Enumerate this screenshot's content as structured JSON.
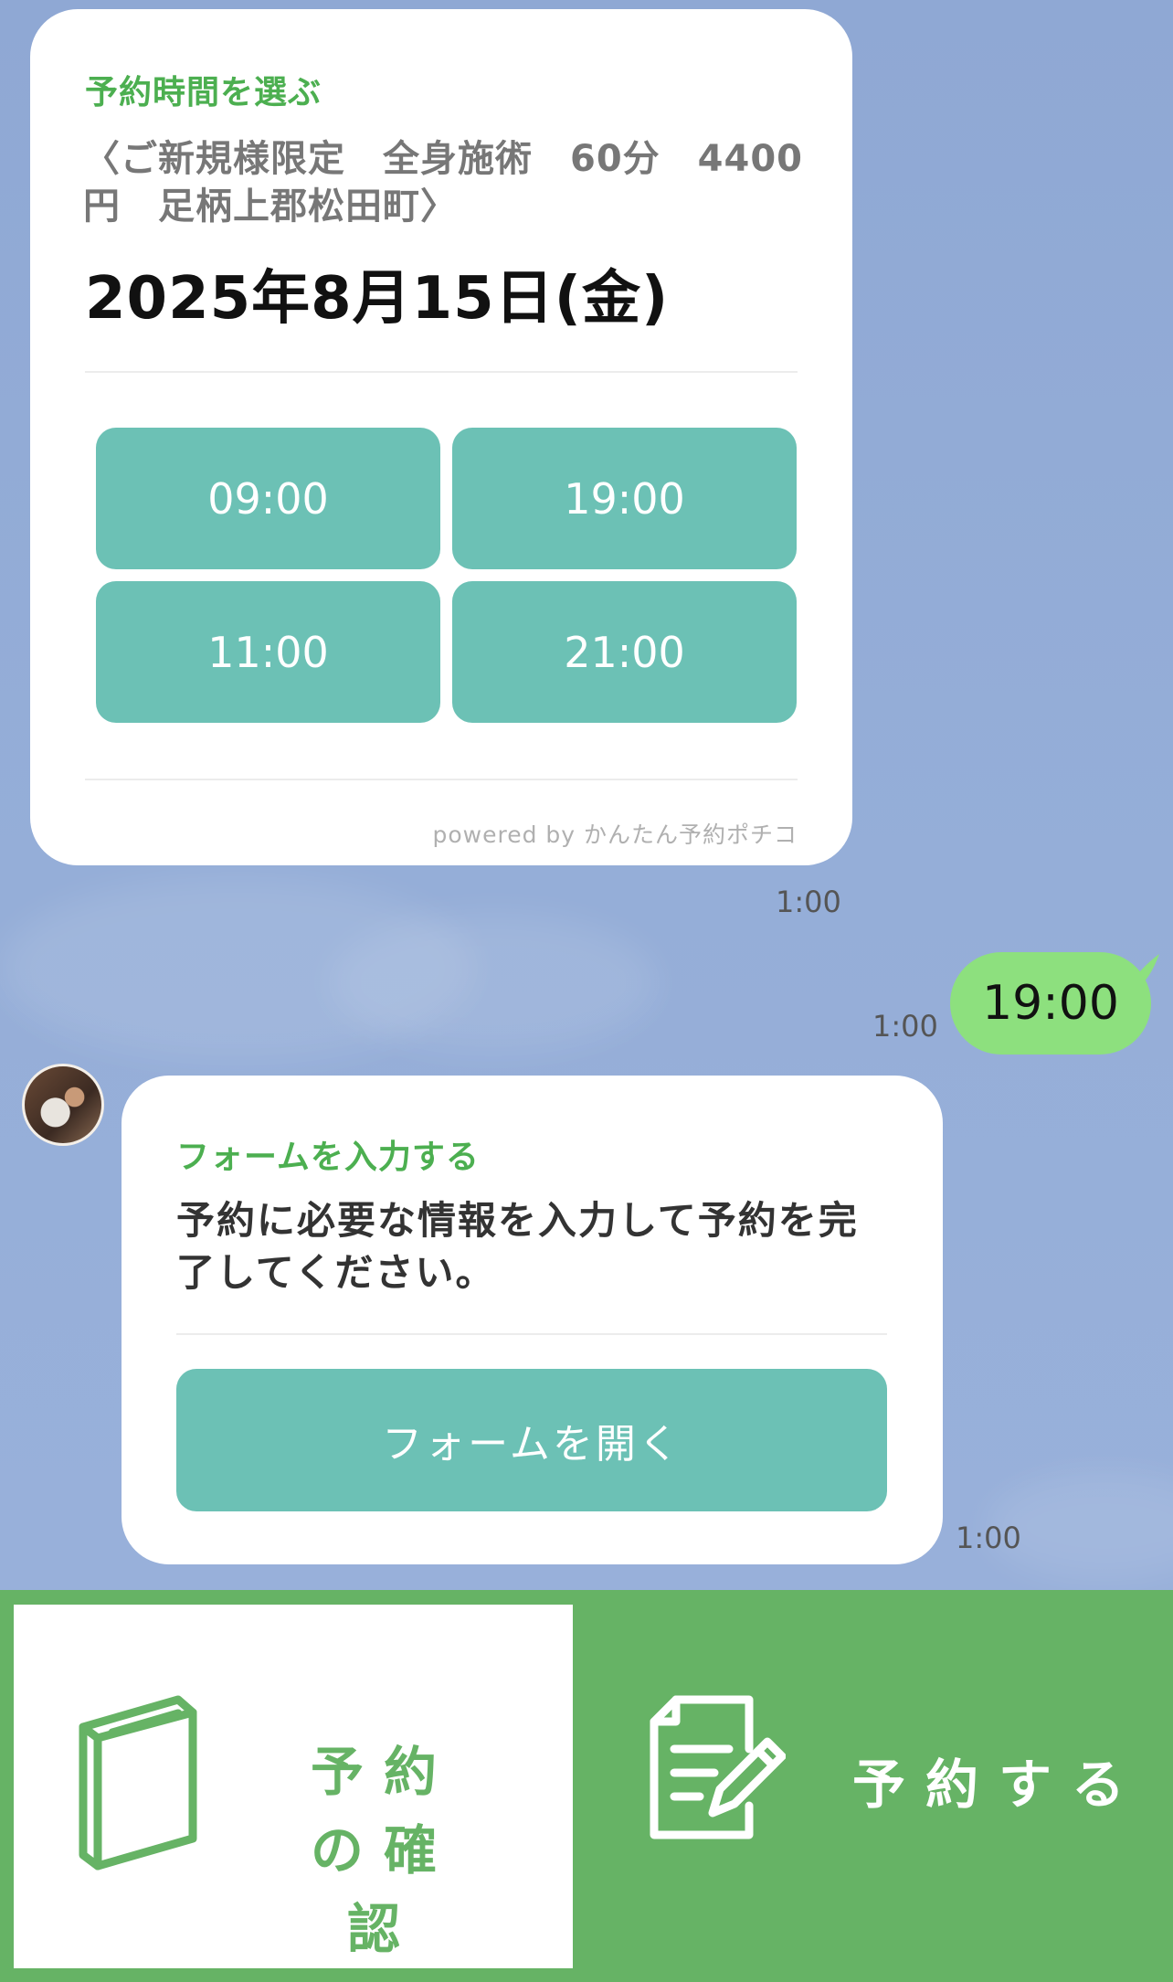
{
  "timeslot_card": {
    "label": "予約時間を選ぶ",
    "subtitle": "〈ご新規様限定　全身施術　60分　4400円　足柄上郡松田町〉",
    "date": "2025年8月15日(金)",
    "slots": [
      "09:00",
      "19:00",
      "11:00",
      "21:00"
    ],
    "powered_by": "powered by かんたん予約ポチコ",
    "time": "1:00"
  },
  "sent_message": {
    "text": "19:00",
    "time": "1:00"
  },
  "form_card": {
    "label": "フォームを入力する",
    "message": "予約に必要な情報を入力して予約を完了してください。",
    "button": "フォームを開く",
    "time": "1:00"
  },
  "rich_menu": {
    "left_label": "予約の確認",
    "left_icon": "book-icon",
    "right_label": "予約する",
    "right_icon": "document-pen-icon",
    "accent": "#66b365"
  },
  "colors": {
    "chat_background": "#92abd4",
    "teal_button": "#6cc1b5",
    "green_label": "#4caf50",
    "sent_bubble": "#8de07e"
  }
}
